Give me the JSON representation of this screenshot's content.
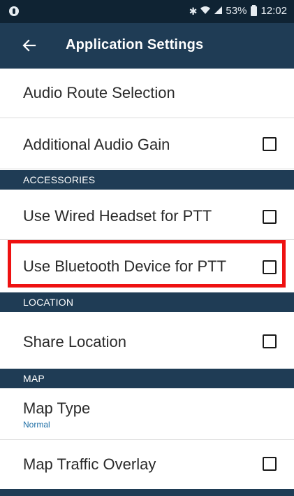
{
  "status_bar": {
    "left_icon": "circle-notification-icon",
    "bluetooth_icon": "bluetooth-icon",
    "wifi_icon": "wifi-icon",
    "signal_icon": "signal-icon",
    "battery_text": "53%",
    "battery_icon": "battery-icon",
    "time": "12:02"
  },
  "app_bar": {
    "back_icon": "back-arrow-icon",
    "title": "Application Settings"
  },
  "settings": {
    "audio_route_selection": "Audio Route Selection",
    "additional_audio_gain": "Additional Audio Gain",
    "accessories_header": "ACCESSORIES",
    "wired_headset_ptt": "Use Wired Headset for PTT",
    "bluetooth_device_ptt": "Use Bluetooth Device for PTT",
    "location_header": "LOCATION",
    "share_location": "Share Location",
    "map_header": "MAP",
    "map_type": "Map Type",
    "map_type_value": "Normal",
    "map_traffic_overlay": "Map Traffic Overlay"
  },
  "checkbox_states": {
    "additional_audio_gain": false,
    "wired_headset_ptt": false,
    "bluetooth_device_ptt": false,
    "share_location": false,
    "map_traffic_overlay": false
  },
  "colors": {
    "status_bar_bg": "#0f2333",
    "header_bg": "#1f3c55",
    "highlight": "#ee1111",
    "subtitle": "#1f6fa6"
  }
}
